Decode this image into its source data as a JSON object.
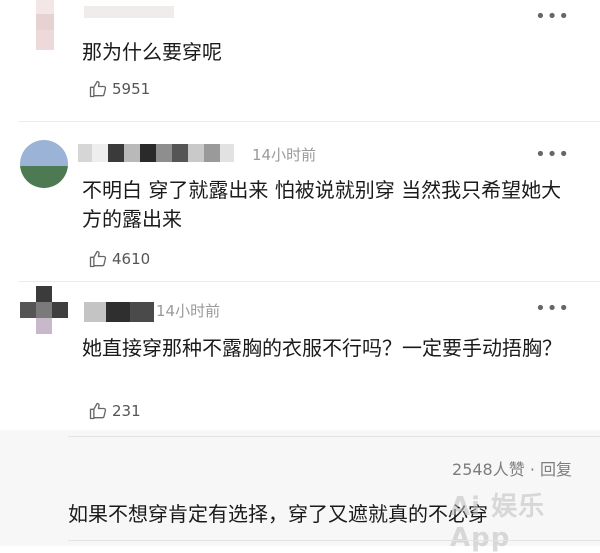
{
  "comments": [
    {
      "time": "",
      "text": "那为什么要穿呢",
      "likes": "5951"
    },
    {
      "time": "14小时前",
      "text": "不明白 穿了就露出来 怕被说就别穿 当然我只希望她大方的露出来",
      "likes": "4610"
    },
    {
      "time": "14小时前",
      "text": "她直接穿那种不露胸的衣服不行吗？一定要手动捂胸？",
      "likes": "231"
    }
  ],
  "reply_block": {
    "stats": "2548人赞 · 回复",
    "text": "如果不想穿肯定有选择，穿了又遮就真的不必穿",
    "watermark": "Ai 娱乐App"
  },
  "icons": {
    "like": "thumbs-up-icon",
    "more": "more-dots-icon"
  }
}
